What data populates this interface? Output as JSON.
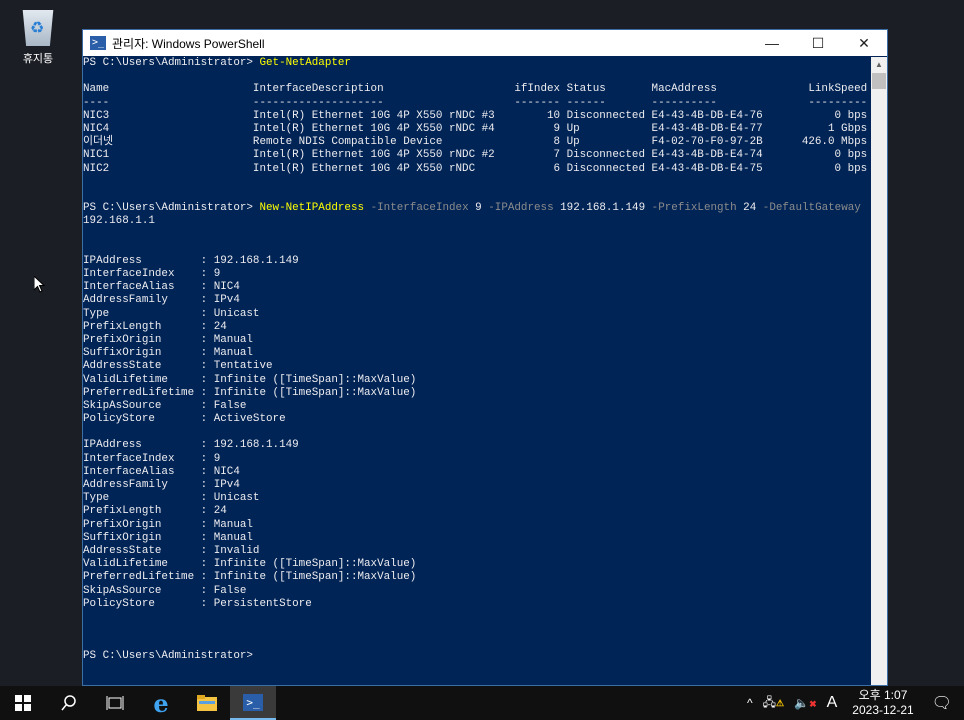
{
  "desktop": {
    "recycle_bin_label": "휴지통"
  },
  "window": {
    "title": "관리자: Windows PowerShell",
    "minimize": "—",
    "maximize": "☐",
    "close": "✕"
  },
  "console": {
    "prompt": "PS C:\\Users\\Administrator> ",
    "cmd1": "Get-NetAdapter",
    "table": {
      "headers": [
        "Name",
        "InterfaceDescription",
        "ifIndex",
        "Status",
        "MacAddress",
        "LinkSpeed"
      ],
      "dashes": [
        "----",
        "--------------------",
        "-------",
        "------",
        "----------",
        "---------"
      ],
      "rows": [
        [
          "NIC3",
          "Intel(R) Ethernet 10G 4P X550 rNDC #3",
          "10",
          "Disconnected",
          "E4-43-4B-DB-E4-76",
          "0 bps"
        ],
        [
          "NIC4",
          "Intel(R) Ethernet 10G 4P X550 rNDC #4",
          "9",
          "Up",
          "E4-43-4B-DB-E4-77",
          "1 Gbps"
        ],
        [
          "이더넷",
          "Remote NDIS Compatible Device",
          "8",
          "Up",
          "F4-02-70-F0-97-2B",
          "426.0 Mbps"
        ],
        [
          "NIC1",
          "Intel(R) Ethernet 10G 4P X550 rNDC #2",
          "7",
          "Disconnected",
          "E4-43-4B-DB-E4-74",
          "0 bps"
        ],
        [
          "NIC2",
          "Intel(R) Ethernet 10G 4P X550 rNDC",
          "6",
          "Disconnected",
          "E4-43-4B-DB-E4-75",
          "0 bps"
        ]
      ]
    },
    "cmd2": [
      {
        "t": "New-NetIPAddress",
        "k": "cmd"
      },
      {
        "t": " "
      },
      {
        "t": "-InterfaceIndex",
        "k": "param"
      },
      {
        "t": " 9 "
      },
      {
        "t": "-IPAddress",
        "k": "param"
      },
      {
        "t": " 192.168.1.149 "
      },
      {
        "t": "-PrefixLength",
        "k": "param"
      },
      {
        "t": " 24 "
      },
      {
        "t": "-DefaultGateway",
        "k": "param"
      }
    ],
    "cmd2_wrap": "192.168.1.1",
    "results": [
      [
        [
          "IPAddress",
          "192.168.1.149"
        ],
        [
          "InterfaceIndex",
          "9"
        ],
        [
          "InterfaceAlias",
          "NIC4"
        ],
        [
          "AddressFamily",
          "IPv4"
        ],
        [
          "Type",
          "Unicast"
        ],
        [
          "PrefixLength",
          "24"
        ],
        [
          "PrefixOrigin",
          "Manual"
        ],
        [
          "SuffixOrigin",
          "Manual"
        ],
        [
          "AddressState",
          "Tentative"
        ],
        [
          "ValidLifetime",
          "Infinite ([TimeSpan]::MaxValue)"
        ],
        [
          "PreferredLifetime",
          "Infinite ([TimeSpan]::MaxValue)"
        ],
        [
          "SkipAsSource",
          "False"
        ],
        [
          "PolicyStore",
          "ActiveStore"
        ]
      ],
      [
        [
          "IPAddress",
          "192.168.1.149"
        ],
        [
          "InterfaceIndex",
          "9"
        ],
        [
          "InterfaceAlias",
          "NIC4"
        ],
        [
          "AddressFamily",
          "IPv4"
        ],
        [
          "Type",
          "Unicast"
        ],
        [
          "PrefixLength",
          "24"
        ],
        [
          "PrefixOrigin",
          "Manual"
        ],
        [
          "SuffixOrigin",
          "Manual"
        ],
        [
          "AddressState",
          "Invalid"
        ],
        [
          "ValidLifetime",
          "Infinite ([TimeSpan]::MaxValue)"
        ],
        [
          "PreferredLifetime",
          "Infinite ([TimeSpan]::MaxValue)"
        ],
        [
          "SkipAsSource",
          "False"
        ],
        [
          "PolicyStore",
          "PersistentStore"
        ]
      ]
    ]
  },
  "taskbar": {
    "clock_time": "오후 1:07",
    "clock_date": "2023-12-21",
    "ime": "A"
  },
  "colors": {
    "console_bg": "#012456",
    "command": "#ffff00",
    "param": "#8c8c8c"
  }
}
